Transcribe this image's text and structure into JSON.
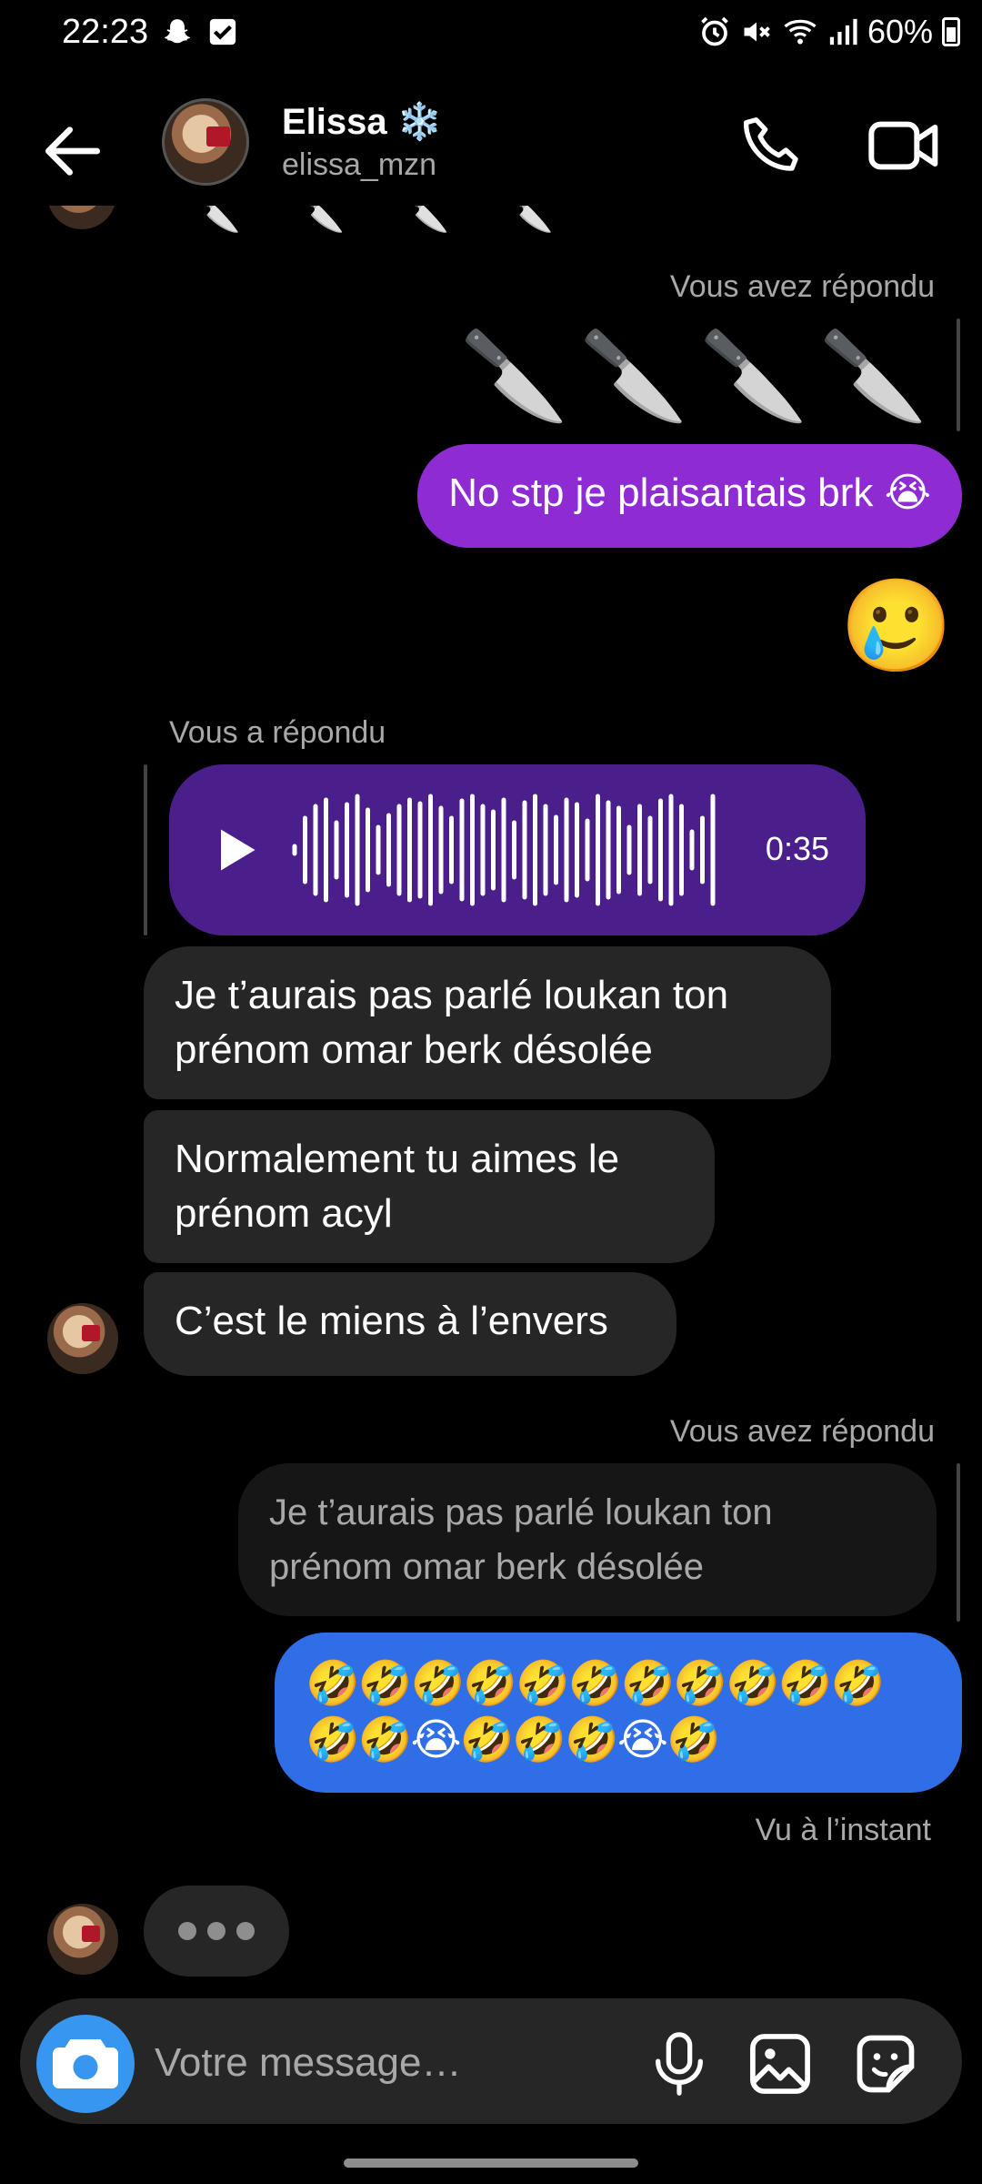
{
  "status_bar": {
    "time": "22:23",
    "battery": "60%",
    "left_icons": [
      "snapchat-icon",
      "checkbox-icon"
    ],
    "right_icons": [
      "alarm-icon",
      "mute-icon",
      "wifi-icon",
      "signal-icon",
      "battery-icon"
    ]
  },
  "header": {
    "name": "Elissa ❄️",
    "username": "elissa_mzn",
    "back_icon": "arrow-left-icon",
    "call_icon": "phone-icon",
    "video_icon": "video-camera-icon"
  },
  "messages": {
    "reply_label_1": "Vous avez répondu",
    "knives": "🔪🔪🔪🔪",
    "msg_out_1": "No stp je plaisantais brk 😭",
    "emoji_out": "🥲",
    "reply_label_2": "Vous a répondu",
    "voice_duration": "0:35",
    "msg_in_1": "Je t’aurais pas parlé loukan ton prénom omar berk désolée",
    "msg_in_2": "Normalement tu aimes le prénom acyl",
    "msg_in_3": "C’est le miens à l’envers",
    "reply_label_3": "Vous avez répondu",
    "quoted": "Je t’aurais pas parlé loukan ton prénom omar berk désolée",
    "msg_out_2": "🤣🤣🤣🤣🤣🤣🤣🤣🤣🤣🤣🤣🤣😭🤣🤣🤣😭🤣",
    "seen": "Vu à l’instant"
  },
  "composer": {
    "placeholder": "Votre message…",
    "camera_icon": "camera-icon",
    "mic_icon": "microphone-icon",
    "gallery_icon": "image-icon",
    "sticker_icon": "sticker-icon"
  },
  "colors": {
    "background": "#000000",
    "bubble_purple": "#8f2bd3",
    "bubble_blue": "#2f6ee6",
    "bubble_incoming": "#262626",
    "voice_bubble": "#4a1f8c",
    "accent": "#3797f0"
  }
}
